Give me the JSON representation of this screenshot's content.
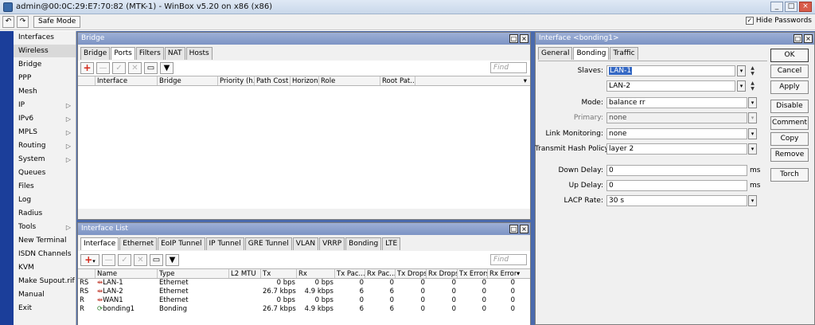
{
  "window": {
    "title": "admin@00:0C:29:E7:70:82 (MTK-1) - WinBox v5.20 on x86 (x86)",
    "controls": [
      "_",
      "□",
      "×"
    ]
  },
  "toolbar": {
    "undo_icon": "undo-icon",
    "redo_icon": "redo-icon",
    "safe_mode_label": "Safe Mode",
    "hide_passwords_label": "Hide Passwords",
    "hide_passwords_checked": true
  },
  "menu": [
    {
      "label": "Interfaces",
      "submenu": false
    },
    {
      "label": "Wireless",
      "submenu": false
    },
    {
      "label": "Bridge",
      "submenu": false
    },
    {
      "label": "PPP",
      "submenu": false
    },
    {
      "label": "Mesh",
      "submenu": false
    },
    {
      "label": "IP",
      "submenu": true
    },
    {
      "label": "IPv6",
      "submenu": true
    },
    {
      "label": "MPLS",
      "submenu": true
    },
    {
      "label": "Routing",
      "submenu": true
    },
    {
      "label": "System",
      "submenu": true
    },
    {
      "label": "Queues",
      "submenu": false
    },
    {
      "label": "Files",
      "submenu": false
    },
    {
      "label": "Log",
      "submenu": false
    },
    {
      "label": "Radius",
      "submenu": false
    },
    {
      "label": "Tools",
      "submenu": true
    },
    {
      "label": "New Terminal",
      "submenu": false
    },
    {
      "label": "ISDN Channels",
      "submenu": false
    },
    {
      "label": "KVM",
      "submenu": false
    },
    {
      "label": "Make Supout.rif",
      "submenu": false
    },
    {
      "label": "Manual",
      "submenu": false
    },
    {
      "label": "Exit",
      "submenu": false
    }
  ],
  "bridge_window": {
    "title": "Bridge",
    "tabs": [
      "Bridge",
      "Ports",
      "Filters",
      "NAT",
      "Hosts"
    ],
    "selected_tab": "Ports",
    "find_placeholder": "Find",
    "columns": [
      "Interface",
      "Bridge",
      "Priority (h...",
      "Path Cost",
      "Horizon",
      "Role",
      "Root Pat..."
    ]
  },
  "interface_list": {
    "title": "Interface List",
    "tabs": [
      "Interface",
      "Ethernet",
      "EoIP Tunnel",
      "IP Tunnel",
      "GRE Tunnel",
      "VLAN",
      "VRRP",
      "Bonding",
      "LTE"
    ],
    "selected_tab": "Interface",
    "find_placeholder": "Find",
    "columns": [
      "Name",
      "Type",
      "L2 MTU",
      "Tx",
      "Rx",
      "Tx Pac...",
      "Rx Pac...",
      "Tx Drops",
      "Rx Drops",
      "Tx Errors",
      "Rx Errors"
    ],
    "rows": [
      {
        "flag": "RS",
        "name": "LAN-1",
        "type": "Ethernet",
        "l2mtu": "",
        "tx": "0 bps",
        "rx": "0 bps",
        "txp": "0",
        "rxp": "0",
        "txd": "0",
        "rxd": "0",
        "txe": "0",
        "rxe": "0"
      },
      {
        "flag": "RS",
        "name": "LAN-2",
        "type": "Ethernet",
        "l2mtu": "",
        "tx": "26.7 kbps",
        "rx": "4.9 kbps",
        "txp": "6",
        "rxp": "6",
        "txd": "0",
        "rxd": "0",
        "txe": "0",
        "rxe": "0"
      },
      {
        "flag": "R",
        "name": "WAN1",
        "type": "Ethernet",
        "l2mtu": "",
        "tx": "0 bps",
        "rx": "0 bps",
        "txp": "0",
        "rxp": "0",
        "txd": "0",
        "rxd": "0",
        "txe": "0",
        "rxe": "0"
      },
      {
        "flag": "R",
        "name": "bonding1",
        "type": "Bonding",
        "l2mtu": "",
        "tx": "26.7 kbps",
        "rx": "4.9 kbps",
        "txp": "6",
        "rxp": "6",
        "txd": "0",
        "rxd": "0",
        "txe": "0",
        "rxe": "0"
      }
    ]
  },
  "interface_dialog": {
    "title": "Interface <bonding1>",
    "tabs": [
      "General",
      "Bonding",
      "Traffic"
    ],
    "selected_tab": "Bonding",
    "slaves_label": "Slaves:",
    "slave1": "LAN-1",
    "slave2": "LAN-2",
    "mode_label": "Mode:",
    "mode_value": "balance rr",
    "primary_label": "Primary:",
    "primary_value": "none",
    "link_monitoring_label": "Link Monitoring:",
    "link_monitoring_value": "none",
    "hash_policy_label": "Transmit Hash Policy:",
    "hash_policy_value": "layer 2",
    "down_delay_label": "Down Delay:",
    "down_delay_value": "0",
    "up_delay_label": "Up Delay:",
    "up_delay_value": "0",
    "lacp_rate_label": "LACP Rate:",
    "lacp_rate_value": "30 s",
    "unit_ms": "ms",
    "buttons": {
      "ok": "OK",
      "cancel": "Cancel",
      "apply": "Apply",
      "disable": "Disable",
      "comment": "Comment",
      "copy": "Copy",
      "remove": "Remove",
      "torch": "Torch"
    }
  },
  "colors": {
    "side_strip": "#1b3e9a",
    "workspace": "#4a6aad",
    "mdi_title": "#8ea2cd",
    "add_red": "#d32a1c"
  }
}
